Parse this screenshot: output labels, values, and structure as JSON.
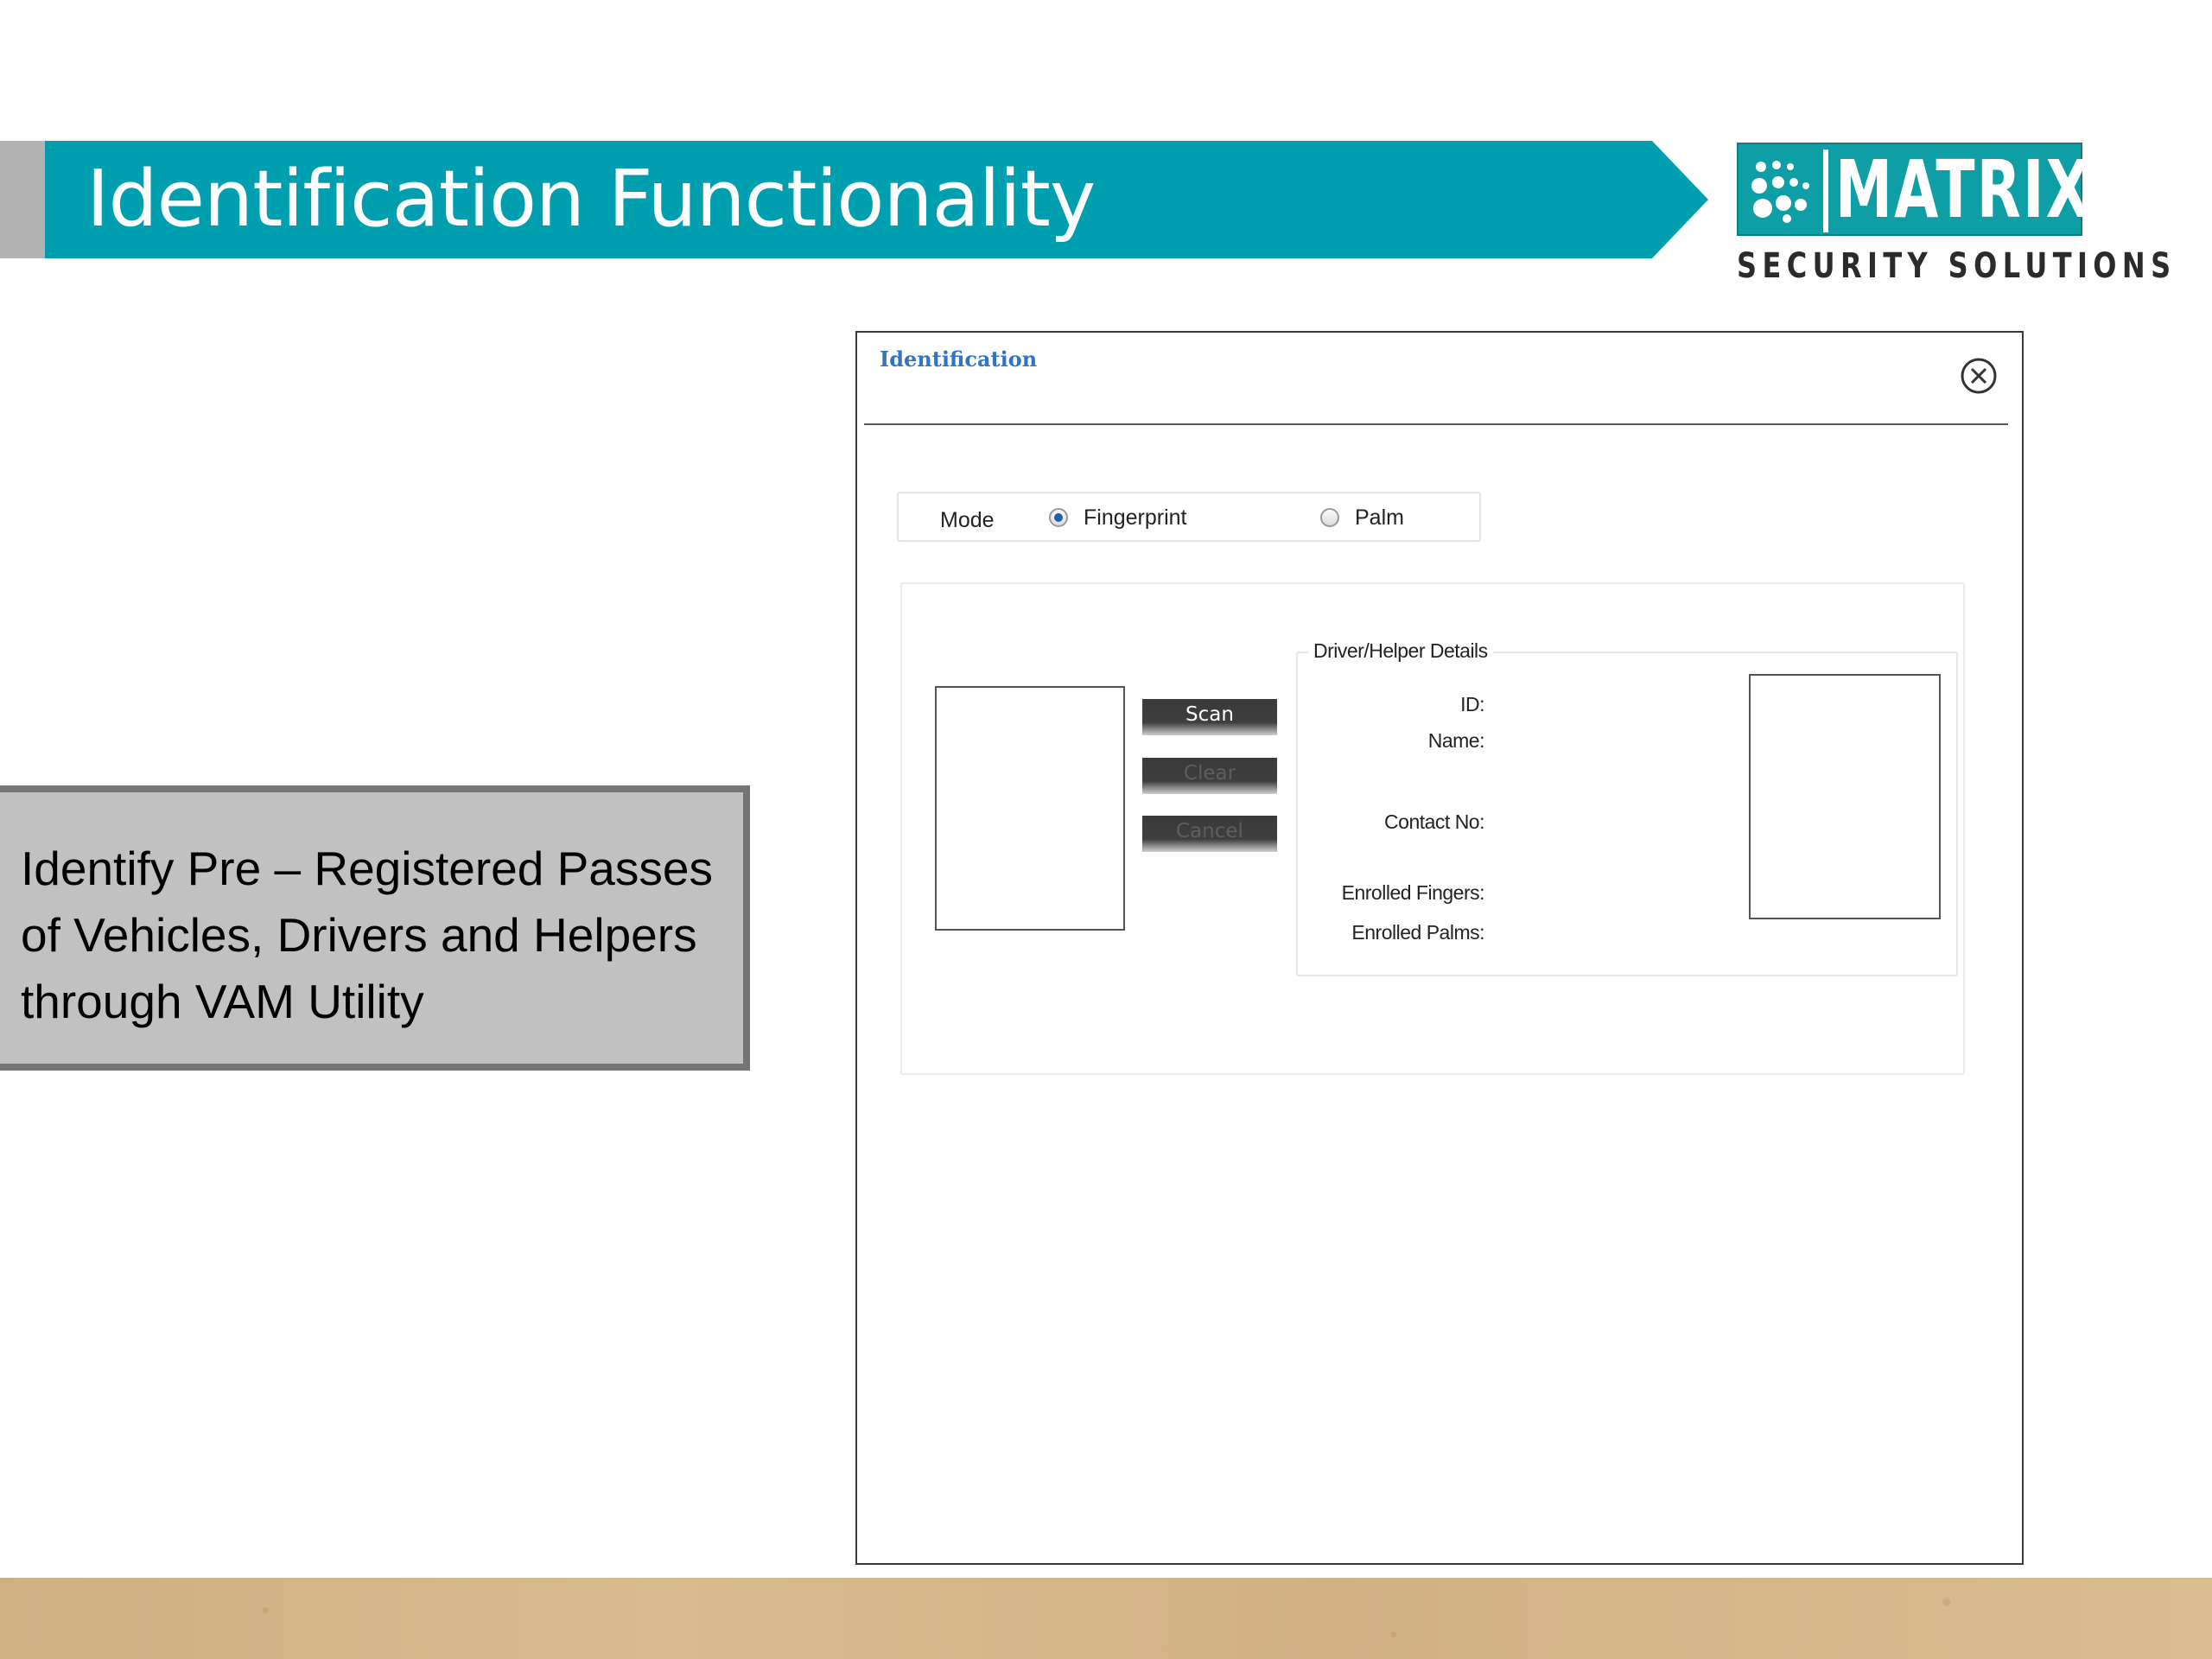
{
  "slide": {
    "title": "Identification Functionality",
    "caption": "Identify Pre – Registered Passes of Vehicles, Drivers and Helpers through VAM Utility"
  },
  "logo": {
    "word": "MATRIX",
    "subtitle": "SECURITY SOLUTIONS",
    "color": "#0e9ea6"
  },
  "colors": {
    "banner": "#009faf",
    "dialog_title": "#2f74c9",
    "caption_bg": "#c1c1c1"
  },
  "dialog": {
    "title": "Identification",
    "close_icon": "circle-x-icon",
    "mode": {
      "label": "Mode",
      "options": [
        {
          "label": "Fingerprint",
          "selected": true
        },
        {
          "label": "Palm",
          "selected": false
        }
      ]
    },
    "buttons": {
      "scan": "Scan",
      "clear": "Clear",
      "cancel": "Cancel"
    },
    "details": {
      "legend": "Driver/Helper Details",
      "id_label": "ID:",
      "name_label": "Name:",
      "contact_label": "Contact No:",
      "fingers_label": "Enrolled Fingers:",
      "palms_label": "Enrolled Palms:"
    }
  }
}
